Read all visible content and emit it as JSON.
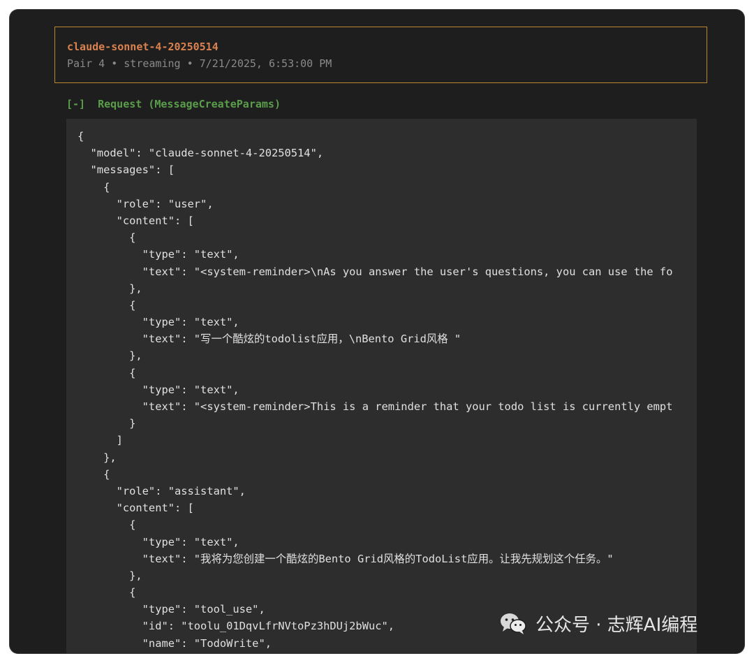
{
  "header": {
    "model": "claude-sonnet-4-20250514",
    "meta": "Pair 4 • streaming • 7/21/2025, 6:53:00 PM"
  },
  "request_section": {
    "toggle": "[-]",
    "title": "Request (MessageCreateParams)"
  },
  "code_lines": [
    "{",
    "  \"model\": \"claude-sonnet-4-20250514\",",
    "  \"messages\": [",
    "    {",
    "      \"role\": \"user\",",
    "      \"content\": [",
    "        {",
    "          \"type\": \"text\",",
    "          \"text\": \"<system-reminder>\\nAs you answer the user's questions, you can use the fo",
    "        },",
    "        {",
    "          \"type\": \"text\",",
    "          \"text\": \"写一个酷炫的todolist应用，\\nBento Grid风格 \"",
    "        },",
    "        {",
    "          \"type\": \"text\",",
    "          \"text\": \"<system-reminder>This is a reminder that your todo list is currently empt",
    "        }",
    "      ]",
    "    },",
    "    {",
    "      \"role\": \"assistant\",",
    "      \"content\": [",
    "        {",
    "          \"type\": \"text\",",
    "          \"text\": \"我将为您创建一个酷炫的Bento Grid风格的TodoList应用。让我先规划这个任务。\"",
    "        },",
    "        {",
    "          \"type\": \"tool_use\",",
    "          \"id\": \"toolu_01DqvLfrNVtoPz3hDUj2bWuc\",",
    "          \"name\": \"TodoWrite\","
  ],
  "watermark": {
    "text": "公众号 · 志辉AI编程",
    "icon": "wechat-icon"
  },
  "colors": {
    "background": "#1e1e1e",
    "code_panel": "#2d2d2d",
    "header_border": "#b8862f",
    "model_text": "#d9824f",
    "section_header": "#5a9e4c"
  }
}
